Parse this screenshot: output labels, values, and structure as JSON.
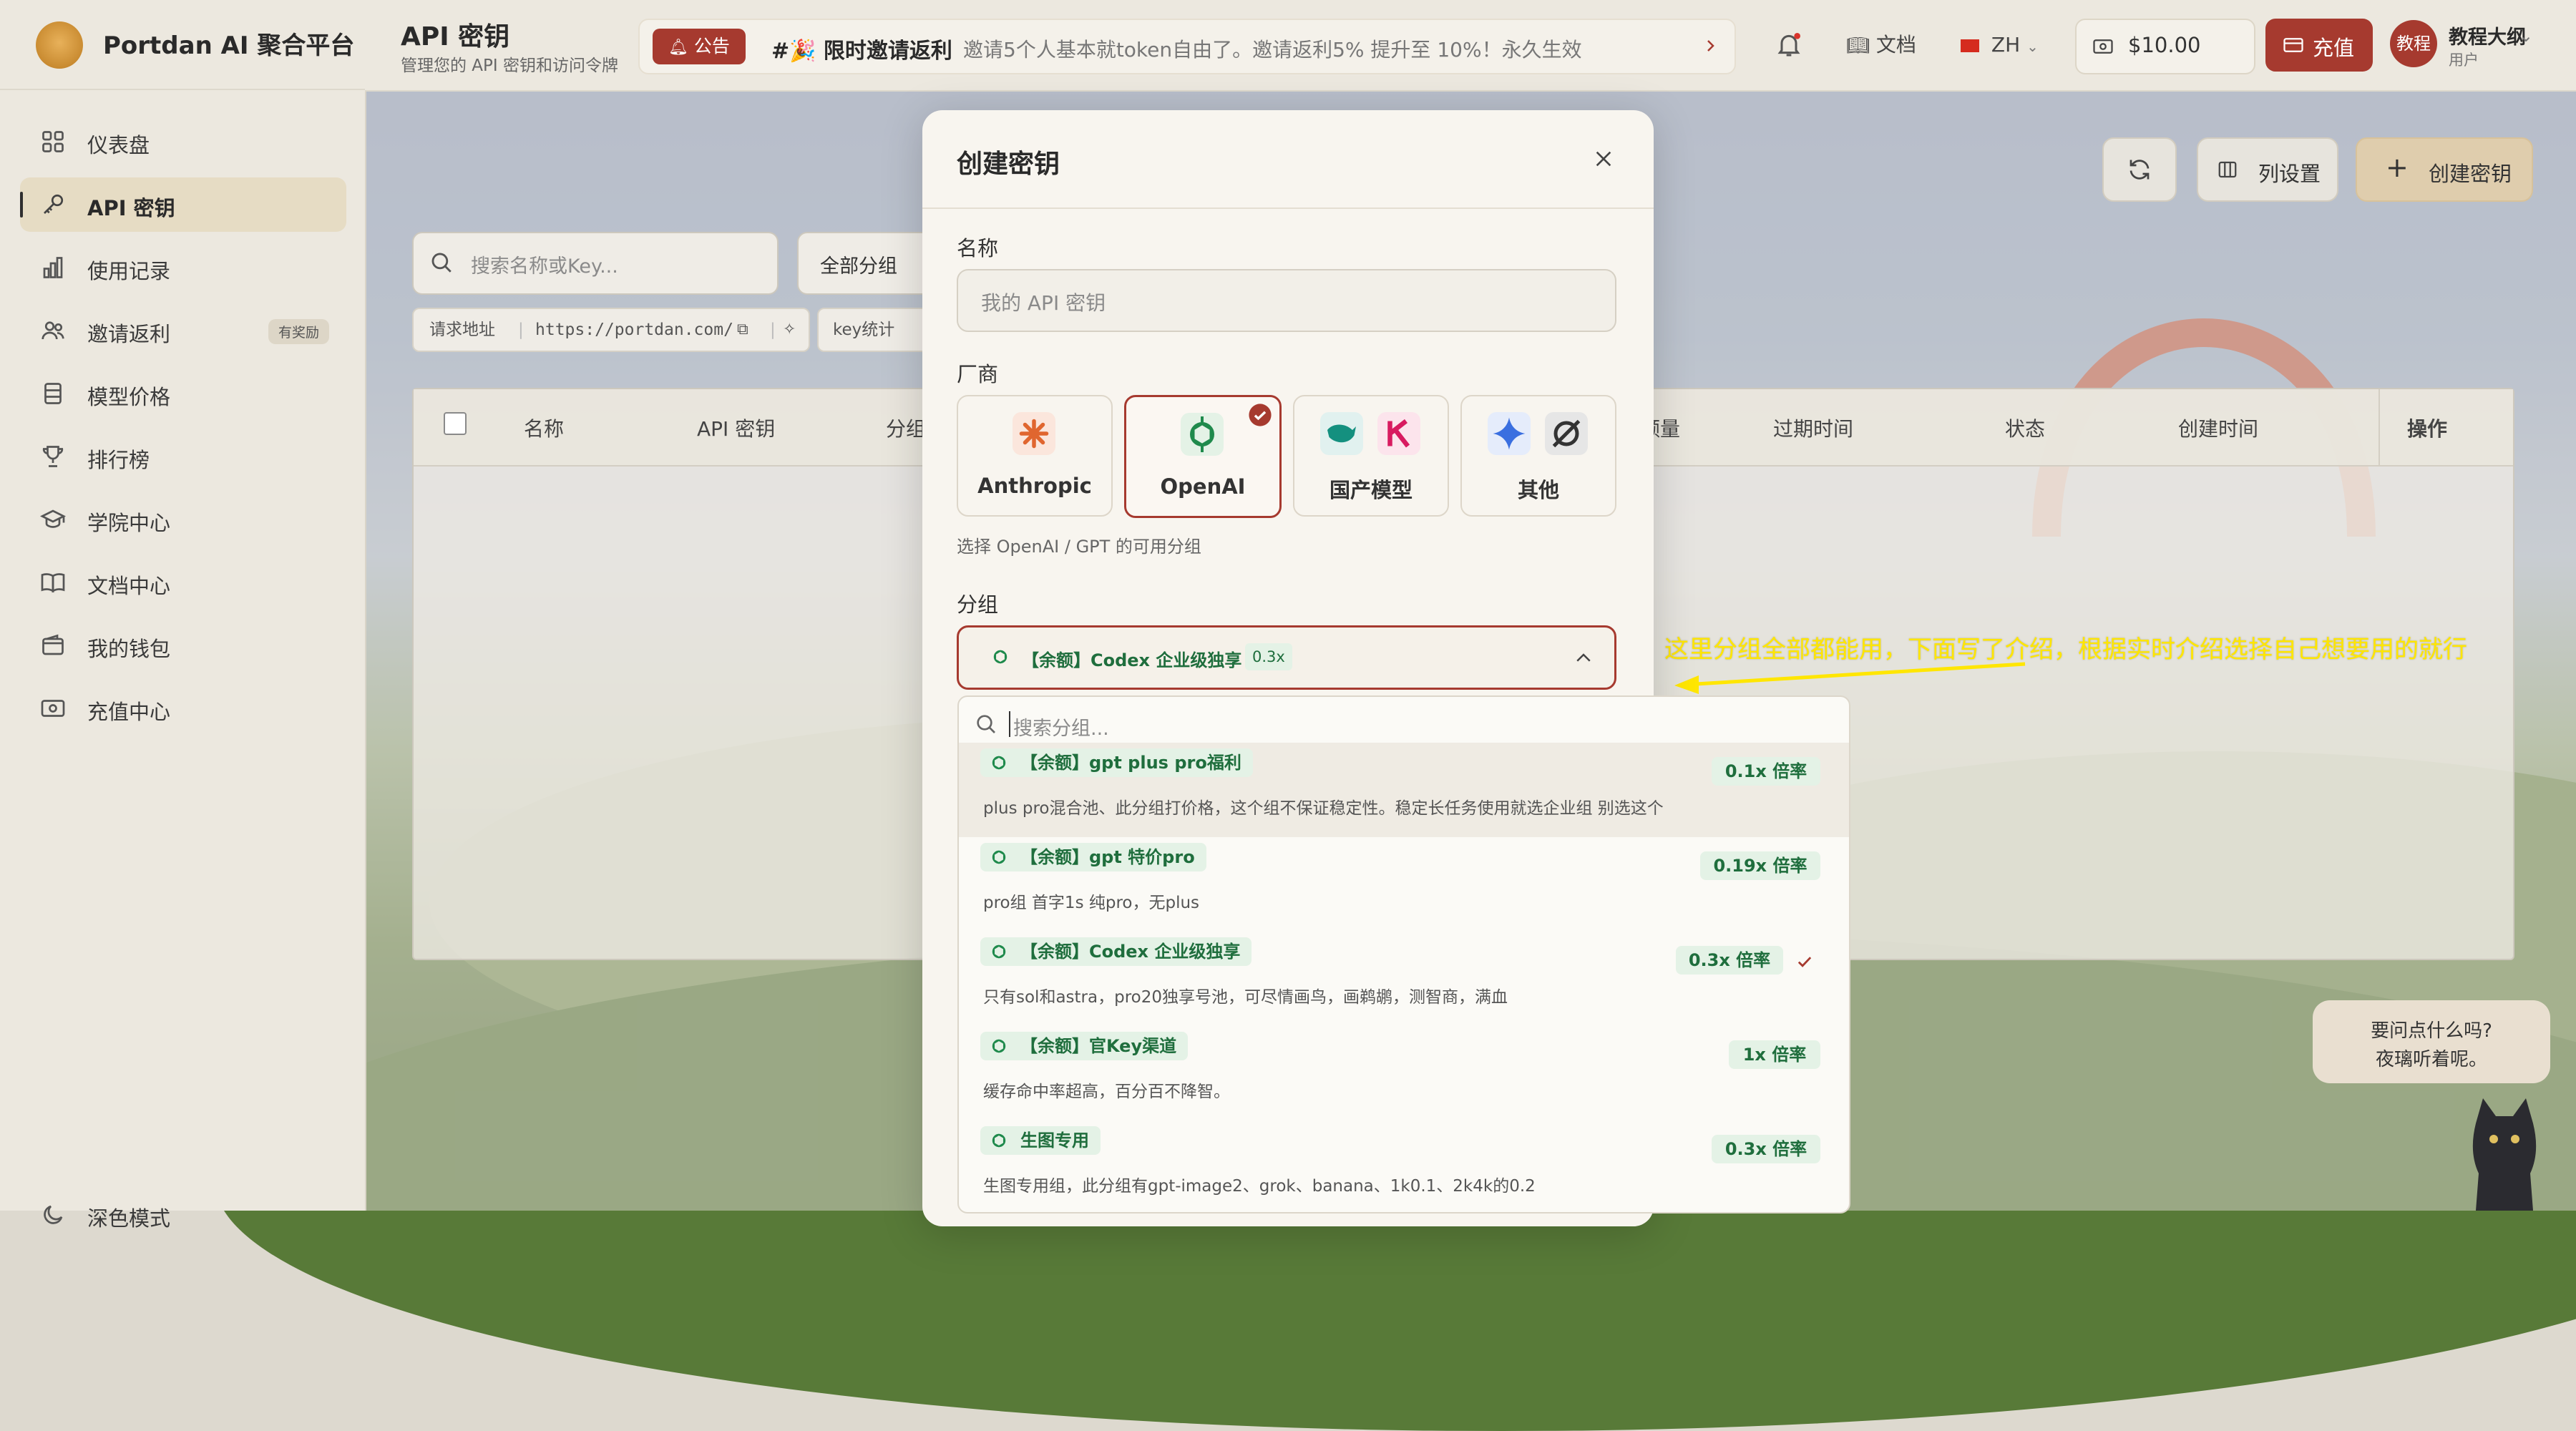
{
  "brand": {
    "name": "Portdan AI 聚合平台"
  },
  "sidebar": {
    "items": [
      {
        "label": "仪表盘",
        "icon": "dashboard-icon"
      },
      {
        "label": "API 密钥",
        "icon": "key-icon",
        "active": true
      },
      {
        "label": "使用记录",
        "icon": "bar-chart-icon"
      },
      {
        "label": "邀请返利",
        "icon": "users-icon",
        "badge": "有奖励"
      },
      {
        "label": "模型价格",
        "icon": "database-icon"
      },
      {
        "label": "排行榜",
        "icon": "trophy-icon"
      },
      {
        "label": "学院中心",
        "icon": "graduation-cap-icon"
      },
      {
        "label": "文档中心",
        "icon": "book-icon"
      },
      {
        "label": "我的钱包",
        "icon": "wallet-icon"
      },
      {
        "label": "充值中心",
        "icon": "card-icon"
      }
    ],
    "footer_label": "深色模式"
  },
  "header": {
    "title": "API 密钥",
    "subtitle": "管理您的 API 密钥和访问令牌",
    "notice_tag": "公告",
    "notice_title": "#🎉 限时邀请返利",
    "notice_text": "邀请5个人基本就token自由了。邀请返利5% 提升至 10%！永久生效",
    "docs_label": "文档",
    "lang_label": "ZH",
    "balance": "$10.00",
    "recharge_label": "充值",
    "user_avatar_text": "教程",
    "user_name": "教程大纲",
    "user_role": "用户"
  },
  "page": {
    "refresh_icon": "refresh-icon",
    "columns_label": "列设置",
    "create_label": "创建密钥",
    "search_placeholder": "搜索名称或Key...",
    "group_filter": "全部分组",
    "request_url_label": "请求地址",
    "request_url": "https://portdan.com/",
    "key_stats_label": "key统计",
    "table_headers": [
      "名称",
      "API 密钥",
      "分组",
      "额量",
      "过期时间",
      "状态",
      "创建时间",
      "操作"
    ]
  },
  "modal": {
    "title": "创建密钥",
    "name_label": "名称",
    "name_placeholder": "我的 API 密钥",
    "vendor_label": "厂商",
    "vendors": [
      {
        "name": "Anthropic",
        "selected": false
      },
      {
        "name": "OpenAI",
        "selected": true
      },
      {
        "name": "国产模型",
        "selected": false
      },
      {
        "name": "其他",
        "selected": false
      }
    ],
    "vendor_hint": "选择 OpenAI / GPT 的可用分组",
    "group_label": "分组",
    "selected_group": "【余额】Codex 企业级独享",
    "selected_rate": "0.3x"
  },
  "dropdown": {
    "search_placeholder": "搜索分组...",
    "items": [
      {
        "name": "【余额】gpt plus pro福利",
        "rate": "0.1x 倍率",
        "desc": "plus pro混合池、此分组打价格，这个组不保证稳定性。稳定长任务使用就选企业组 别选这个",
        "highlighted": true,
        "selected": false
      },
      {
        "name": "【余额】gpt 特价pro",
        "rate": "0.19x 倍率",
        "desc": "pro组 首字1s 纯pro，无plus",
        "highlighted": false,
        "selected": false
      },
      {
        "name": "【余额】Codex 企业级独享",
        "rate": "0.3x 倍率",
        "desc": "只有sol和astra，pro20独享号池，可尽情画鸟，画鹈鹕，测智商，满血",
        "highlighted": false,
        "selected": true
      },
      {
        "name": "【余额】官Key渠道",
        "rate": "1x 倍率",
        "desc": "缓存命中率超高，百分百不降智。",
        "highlighted": false,
        "selected": false
      },
      {
        "name": "生图专用",
        "rate": "0.3x 倍率",
        "desc": "生图专用组，此分组有gpt-image2、grok、banana、1k0.1、2k4k的0.2",
        "highlighted": false,
        "selected": false
      }
    ]
  },
  "annotation": {
    "text": "这里分组全部都能用，下面写了介绍，根据实时介绍选择自己想要用的就行"
  },
  "chat_bubble": {
    "line1": "要问点什么吗?",
    "line2": "夜璃听着呢。"
  },
  "colors": {
    "accent": "#a63a2f",
    "group_tag_bg": "#e4f2e6",
    "group_tag_text": "#1f6e3d",
    "annotation": "#ffe600"
  }
}
